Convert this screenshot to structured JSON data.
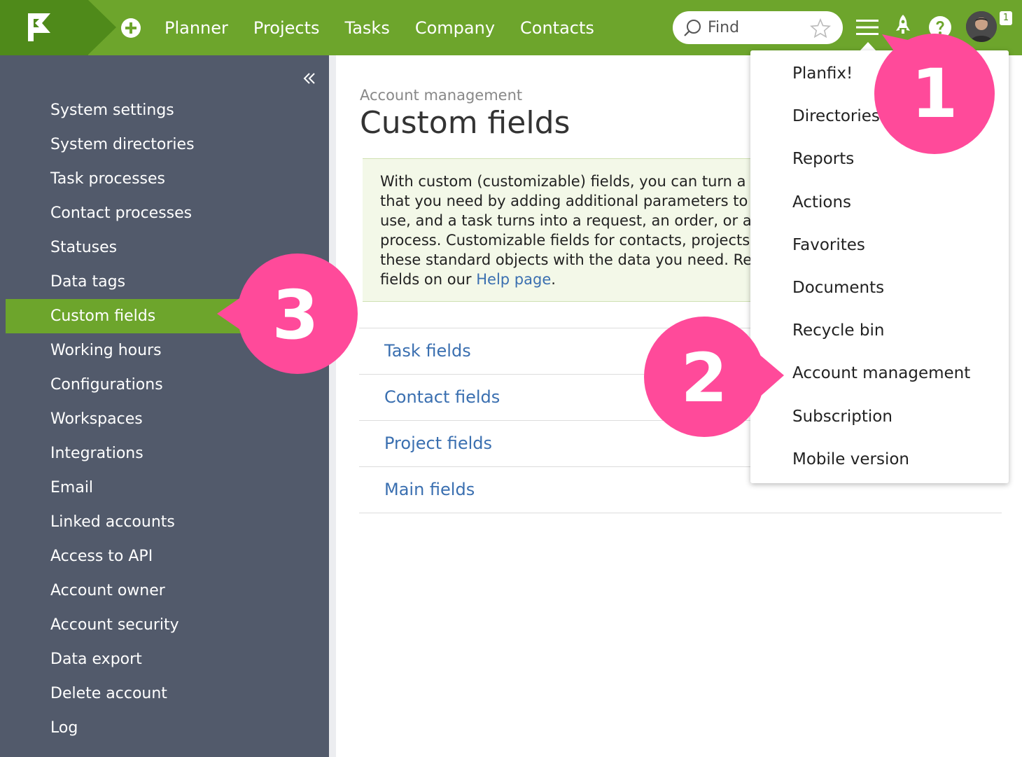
{
  "topbar": {
    "nav": [
      "Planner",
      "Projects",
      "Tasks",
      "Company",
      "Contacts"
    ],
    "search_placeholder": "Find",
    "notification_count": "1"
  },
  "sidebar": {
    "items": [
      "System settings",
      "System directories",
      "Task processes",
      "Contact processes",
      "Statuses",
      "Data tags",
      "Custom fields",
      "Working hours",
      "Configurations",
      "Workspaces",
      "Integrations",
      "Email",
      "Linked accounts",
      "Access to API",
      "Account owner",
      "Account security",
      "Data export",
      "Delete account",
      "Log"
    ],
    "active_index": 6
  },
  "main": {
    "breadcrumb": "Account management",
    "title": "Custom fields",
    "info_lines": [
      "With custom (customizable) fields, you can turn a t",
      "that you need by adding additional parameters to i",
      "use, and a task turns into a request, an order, or ar",
      "process. Customizable fields for contacts, projects",
      "these standard objects with the data you need. Re"
    ],
    "info_last_prefix": "fields on our ",
    "info_link": "Help page",
    "info_last_suffix": ".",
    "field_links": [
      "Task fields",
      "Contact fields",
      "Project fields",
      "Main fields"
    ]
  },
  "dropdown": {
    "items": [
      "Planfix!",
      "Directories",
      "Reports",
      "Actions",
      "Favorites",
      "Documents",
      "Recycle bin",
      "Account management",
      "Subscription",
      "Mobile version"
    ]
  },
  "callouts": [
    "1",
    "2",
    "3"
  ],
  "colors": {
    "green": "#6da52c",
    "dark_green": "#4f8a1a",
    "sidebar": "#525a6b",
    "link": "#3a6fb0",
    "callout_pink": "#ff4a9a"
  }
}
